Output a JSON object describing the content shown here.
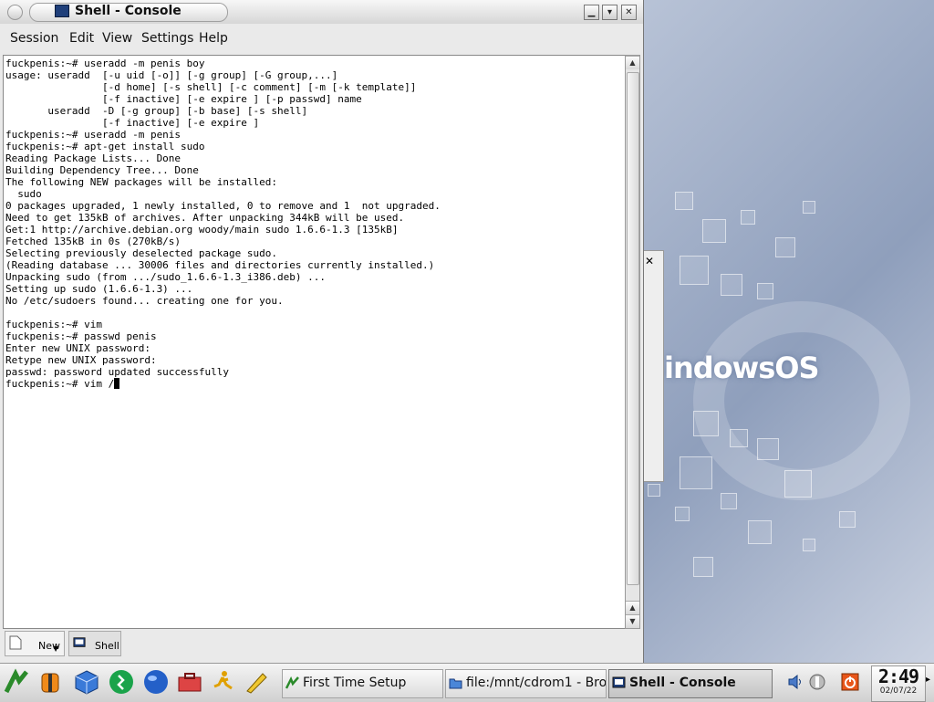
{
  "window": {
    "title": "Shell - Console",
    "menu": [
      "Session",
      "Edit",
      "View",
      "Settings",
      "Help"
    ]
  },
  "terminal": {
    "lines": [
      "fuckpenis:~# useradd -m penis boy",
      "usage: useradd  [-u uid [-o]] [-g group] [-G group,...]",
      "                [-d home] [-s shell] [-c comment] [-m [-k template]]",
      "                [-f inactive] [-e expire ] [-p passwd] name",
      "       useradd  -D [-g group] [-b base] [-s shell]",
      "                [-f inactive] [-e expire ]",
      "fuckpenis:~# useradd -m penis",
      "fuckpenis:~# apt-get install sudo",
      "Reading Package Lists... Done",
      "Building Dependency Tree... Done",
      "The following NEW packages will be installed:",
      "  sudo",
      "0 packages upgraded, 1 newly installed, 0 to remove and 1  not upgraded.",
      "Need to get 135kB of archives. After unpacking 344kB will be used.",
      "Get:1 http://archive.debian.org woody/main sudo 1.6.6-1.3 [135kB]",
      "Fetched 135kB in 0s (270kB/s)",
      "Selecting previously deselected package sudo.",
      "(Reading database ... 30006 files and directories currently installed.)",
      "Unpacking sudo (from .../sudo_1.6.6-1.3_i386.deb) ...",
      "Setting up sudo (1.6.6-1.3) ...",
      "No /etc/sudoers found... creating one for you.",
      "",
      "fuckpenis:~# vim",
      "fuckpenis:~# passwd penis",
      "Enter new UNIX password:",
      "Retype new UNIX password:",
      "passwd: password updated successfully"
    ],
    "prompt_line": "fuckpenis:~# vim /"
  },
  "console_tabs": [
    {
      "label": "New",
      "icon": "new-session-icon"
    },
    {
      "label": "Shell",
      "icon": "terminal-icon"
    }
  ],
  "desktop": {
    "logo_text": "indowsOS"
  },
  "taskbar": {
    "quick_launch": [
      "start-menu-icon",
      "lifevest-icon",
      "cube-icon",
      "runner-icon",
      "globe-icon",
      "toolbox-icon",
      "runner-alt-icon",
      "pen-icon"
    ],
    "tasks": [
      {
        "label": "First Time Setup",
        "icon": "setup-icon",
        "active": false
      },
      {
        "label": "file:/mnt/cdrom1 - Brow",
        "icon": "folder-icon",
        "active": false
      },
      {
        "label": "Shell - Console",
        "icon": "terminal-icon",
        "active": true
      }
    ],
    "tray": [
      "speaker-icon",
      "network-icon",
      "power-icon"
    ],
    "clock_time": "2:49",
    "clock_date": "02/07/22"
  },
  "colors": {
    "terminal_bg": "#ffffff",
    "terminal_fg": "#000000",
    "title_icon": "#1f3f7a",
    "power_icon": "#e8561a"
  }
}
